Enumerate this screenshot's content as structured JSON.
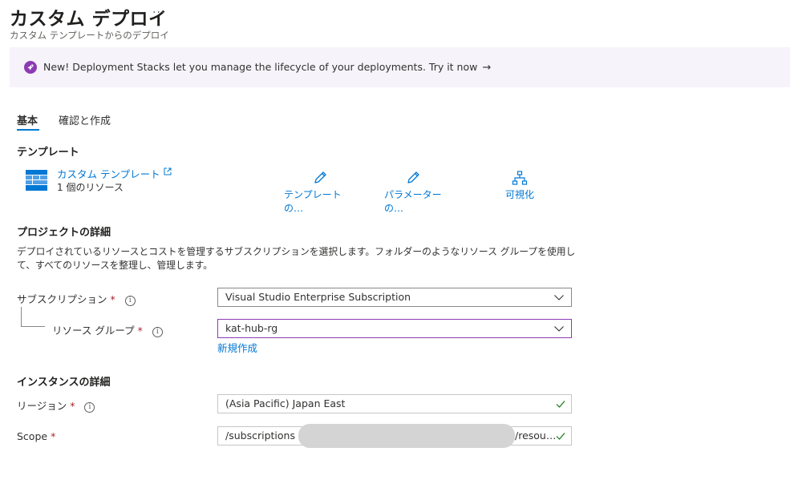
{
  "header": {
    "title": "カスタム デプロイ",
    "more": "···",
    "subtitle": "カスタム テンプレートからのデプロイ"
  },
  "banner": {
    "icon": "rocket-icon",
    "text": "New! Deployment Stacks let you manage the lifecycle of your deployments. Try it now",
    "arrow": "→",
    "accent": "#8b3bb4"
  },
  "tabs": [
    {
      "label": "基本",
      "active": true
    },
    {
      "label": "確認と作成",
      "active": false
    }
  ],
  "template_section": {
    "title": "テンプレート",
    "template_link": "カスタム テンプレート",
    "resource_count": "1 個のリソース",
    "actions": [
      {
        "label": "テンプレートの…",
        "icon": "pencil-icon"
      },
      {
        "label": "パラメーターの…",
        "icon": "pencil-icon"
      },
      {
        "label": "可視化",
        "icon": "hierarchy-icon"
      }
    ]
  },
  "project_section": {
    "title": "プロジェクトの詳細",
    "description": "デプロイされているリソースとコストを管理するサブスクリプションを選択します。フォルダーのようなリソース グループを使用して、すべてのリソースを整理し、管理します。",
    "subscription": {
      "label": "サブスクリプション",
      "required": "*",
      "value": "Visual Studio Enterprise Subscription"
    },
    "resource_group": {
      "label": "リソース グループ",
      "required": "*",
      "value": "kat-hub-rg"
    },
    "create_new": "新規作成"
  },
  "instance_section": {
    "title": "インスタンスの詳細",
    "region": {
      "label": "リージョン",
      "required": "*",
      "value": "(Asia Pacific) Japan East"
    },
    "scope": {
      "label": "Scope",
      "required": "*",
      "value_start": "/subscriptions",
      "value_end": "/resou…"
    }
  },
  "colors": {
    "link": "#0078d4",
    "required": "#a4262c",
    "valid": "#107c10",
    "banner_bg": "#f7f3fa"
  }
}
